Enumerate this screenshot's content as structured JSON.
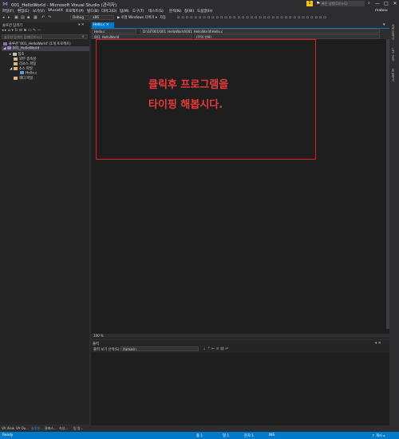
{
  "window": {
    "title": "001_HelloWorld - Microsoft Visual Studio (관리자)",
    "logo_icon": "visual-studio-logo",
    "notification_count": "1",
    "quick_launch_placeholder": "빠른 실행(Ctrl+Q)",
    "minimize": "—",
    "maximize": "□",
    "close": "✕"
  },
  "menu": {
    "items": [
      "파일(F)",
      "편집(E)",
      "보기(V)",
      "VAssistX",
      "프로젝트(P)",
      "빌드(B)",
      "디버그(D)",
      "팀(M)",
      "도구(T)",
      "테스트(S)",
      "분석(N)",
      "창(W)",
      "도움말(H)"
    ],
    "user": "mabou"
  },
  "toolbar": {
    "config": "Debug",
    "platform": "x86",
    "start_label": "▶ 로컬 Windows 디버거 ▾",
    "auto_label": "자동"
  },
  "solution_explorer": {
    "title": "솔루션 탐색기",
    "pin": "▾ ✕",
    "search_placeholder": "솔루션 탐색기 검색(Ctrl+;)",
    "items": [
      {
        "label": "솔루션 '001_HelloWorld' (1개 프로젝트)"
      },
      {
        "label": "001_HelloWorld"
      },
      {
        "label": "참조"
      },
      {
        "label": "외부 종속성"
      },
      {
        "label": "리소스 파일"
      },
      {
        "label": "소스 파일"
      },
      {
        "label": "Hello.c"
      },
      {
        "label": "헤더 파일"
      }
    ],
    "bottom_tabs": [
      "VA View",
      "VA Ou...",
      "솔루션...",
      "클래스...",
      "속성...",
      "팀 탐..."
    ]
  },
  "editor": {
    "file_tab": "Hello.c",
    "nav_left": "Hello.c",
    "nav_path": "D:\\GIT001\\001_HelloWorld\\001_HelloWorld\\Hello.c",
    "nav_project": "001_HelloWorld",
    "nav_scope": "(전역 범위)",
    "zoom": "100 %",
    "annotation_line1": "클릭후 프로그램을",
    "annotation_line2": "타이핑 해봅시다."
  },
  "right_tabs": [
    "서버 탐색기",
    "도구 상자",
    "팀 탐색기"
  ],
  "output": {
    "title": "출력",
    "show_from_label": "출력 보기 선택(S):",
    "source": "Xamarin"
  },
  "status": {
    "ready": "Ready",
    "line": "줄 1",
    "col": "열 1",
    "ch": "문자 1",
    "ins": "INS",
    "publish": "↑ 게시 ▴"
  },
  "colors": {
    "accent": "#007acc",
    "annotation": "#e83a3a",
    "notification": "#f0c419"
  }
}
